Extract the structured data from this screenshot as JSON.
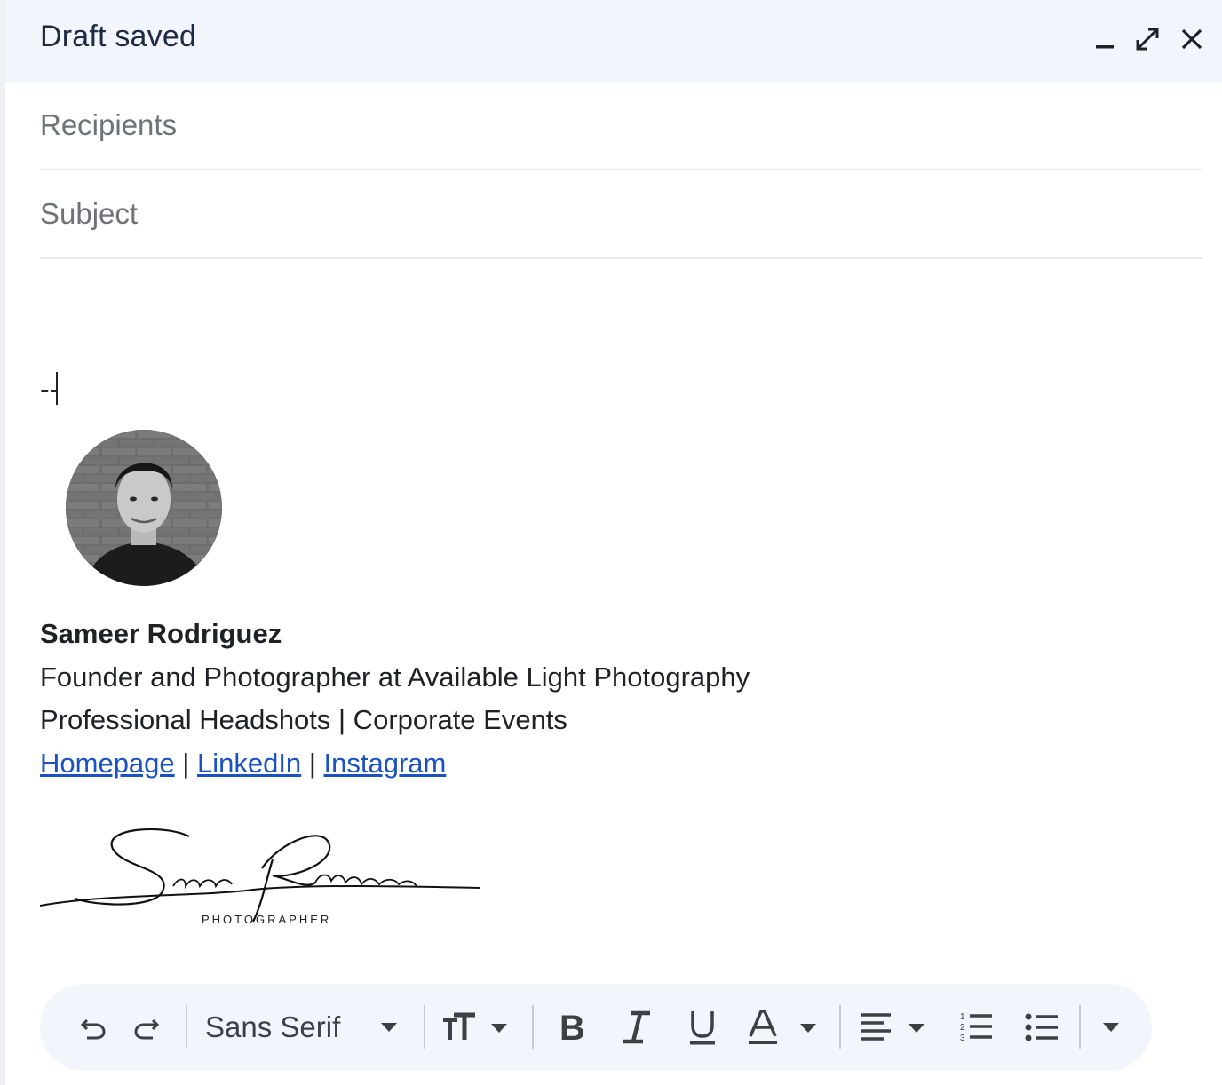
{
  "header": {
    "title": "Draft saved",
    "buttons": [
      "minimize-icon",
      "fullscreen-icon",
      "close-icon"
    ]
  },
  "fields": {
    "recipients_placeholder": "Recipients",
    "subject_placeholder": "Subject"
  },
  "body": {
    "sig_dash": "--"
  },
  "signature": {
    "name": "Sameer Rodriguez",
    "title": "Founder and Photographer at Available Light Photography",
    "services": "Professional Headshots | Corporate Events",
    "links": [
      {
        "label": "Homepage"
      },
      {
        "label": "LinkedIn"
      },
      {
        "label": "Instagram"
      }
    ],
    "separator": "|",
    "signature_text": "Sameer Rodriguez",
    "signature_subtitle": "PHOTOGRAPHER"
  },
  "toolbar": {
    "font_family": "Sans Serif",
    "colors": {
      "background": "#f2f6fc",
      "link": "#1a52c4"
    }
  }
}
